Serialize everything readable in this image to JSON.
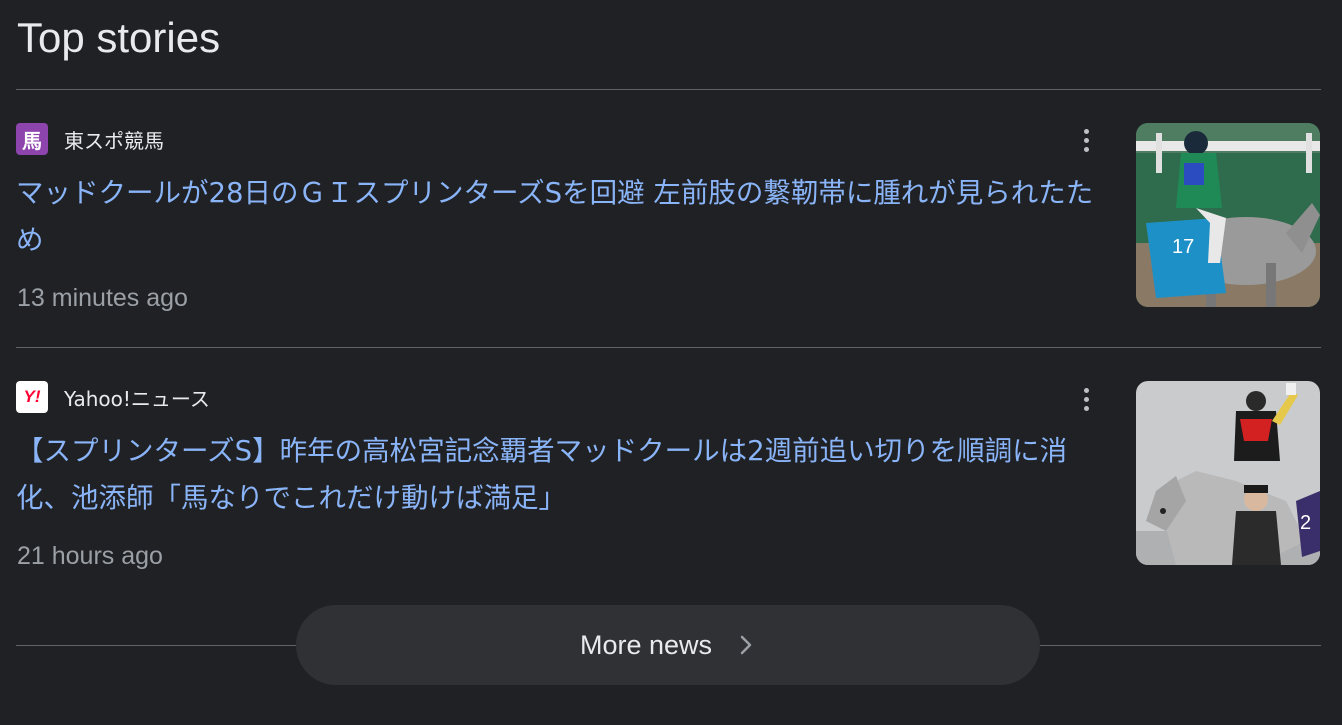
{
  "section": {
    "title": "Top stories"
  },
  "stories": [
    {
      "source": "東スポ競馬",
      "source_icon": "uma-favicon",
      "source_icon_glyph": "馬",
      "headline": "マッドクールが28日のＧＩスプリンターズSを回避 左前肢の繋靭帯に腫れが見られたため",
      "time": "13 minutes ago",
      "menu_icon": "more-vert-icon"
    },
    {
      "source": "Yahoo!ニュース",
      "source_icon": "yahoo-favicon",
      "source_icon_glyph": "Y!",
      "headline": "【スプリンターズS】昨年の高松宮記念覇者マッドクールは2週前追い切りを順調に消化、池添師「馬なりでこれだけ動けば満足」",
      "time": "21 hours ago",
      "menu_icon": "more-vert-icon"
    }
  ],
  "more_news": {
    "label": "More news",
    "icon": "chevron-right-icon"
  },
  "colors": {
    "background": "#202124",
    "link": "#8ab4f8",
    "text": "#e8eaed",
    "muted": "#9aa0a6",
    "divider": "#5f6368",
    "button_bg": "#303134"
  }
}
